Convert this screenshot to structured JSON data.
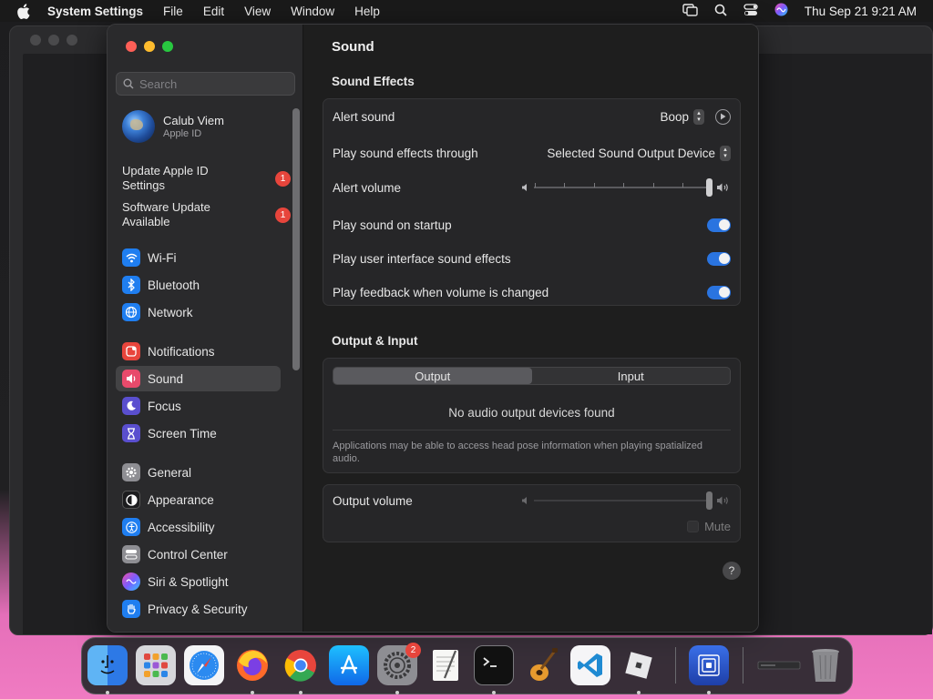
{
  "menubar": {
    "app_name": "System Settings",
    "items": [
      "File",
      "Edit",
      "View",
      "Window",
      "Help"
    ],
    "clock": "Thu Sep 21  9:21 AM"
  },
  "sidebar": {
    "search_placeholder": "Search",
    "account": {
      "name": "Calub Viem",
      "subtitle": "Apple ID"
    },
    "notices": [
      {
        "label": "Update Apple ID Settings",
        "badge": "1"
      },
      {
        "label": "Software Update Available",
        "badge": "1"
      }
    ],
    "items": [
      {
        "label": "Wi-Fi",
        "icon": "wifi-icon",
        "color": "#1f7ef0"
      },
      {
        "label": "Bluetooth",
        "icon": "bluetooth-icon",
        "color": "#1f7ef0"
      },
      {
        "label": "Network",
        "icon": "network-globe-icon",
        "color": "#1f7ef0"
      },
      {
        "label": "Notifications",
        "icon": "notifications-icon",
        "color": "#e8453c"
      },
      {
        "label": "Sound",
        "icon": "sound-icon",
        "color": "#e84a6b"
      },
      {
        "label": "Focus",
        "icon": "focus-moon-icon",
        "color": "#5a4fcf"
      },
      {
        "label": "Screen Time",
        "icon": "screen-time-hourglass-icon",
        "color": "#5a4fcf"
      },
      {
        "label": "General",
        "icon": "general-gear-icon",
        "color": "#8e8e93"
      },
      {
        "label": "Appearance",
        "icon": "appearance-icon",
        "color": "#1c1c1e"
      },
      {
        "label": "Accessibility",
        "icon": "accessibility-icon",
        "color": "#1f7ef0"
      },
      {
        "label": "Control Center",
        "icon": "control-center-icon",
        "color": "#8e8e93"
      },
      {
        "label": "Siri & Spotlight",
        "icon": "siri-icon",
        "color": "#b23bd4"
      },
      {
        "label": "Privacy & Security",
        "icon": "privacy-hand-icon",
        "color": "#1f7ef0"
      }
    ],
    "selected": "Sound"
  },
  "content": {
    "title": "Sound",
    "sound_effects": {
      "heading": "Sound Effects",
      "alert_sound": {
        "label": "Alert sound",
        "value": "Boop"
      },
      "play_through": {
        "label": "Play sound effects through",
        "value": "Selected Sound Output Device"
      },
      "alert_volume": {
        "label": "Alert volume",
        "level": 1.0
      },
      "startup": {
        "label": "Play sound on startup",
        "on": true
      },
      "ui_effects": {
        "label": "Play user interface sound effects",
        "on": true
      },
      "feedback": {
        "label": "Play feedback when volume is changed",
        "on": true
      }
    },
    "output_input": {
      "heading": "Output & Input",
      "tabs": [
        "Output",
        "Input"
      ],
      "selected_tab": "Output",
      "empty_message": "No audio output devices found",
      "note": "Applications may be able to access head pose information when playing spatialized audio."
    },
    "output_volume": {
      "label": "Output volume",
      "level": 1.0,
      "mute_label": "Mute",
      "muted": false
    },
    "help": "?"
  },
  "dock": {
    "apps": [
      {
        "name": "Finder",
        "icon": "finder-icon"
      },
      {
        "name": "Launchpad",
        "icon": "launchpad-icon"
      },
      {
        "name": "Safari",
        "icon": "safari-icon"
      },
      {
        "name": "Firefox",
        "icon": "firefox-icon"
      },
      {
        "name": "Chrome",
        "icon": "chrome-icon"
      },
      {
        "name": "App Store",
        "icon": "app-store-icon"
      },
      {
        "name": "System Settings",
        "icon": "system-settings-icon",
        "badge": "2"
      },
      {
        "name": "TextEdit",
        "icon": "textedit-icon"
      },
      {
        "name": "Terminal",
        "icon": "terminal-icon"
      },
      {
        "name": "GarageBand",
        "icon": "garageband-icon"
      },
      {
        "name": "VS Code",
        "icon": "vscode-icon"
      },
      {
        "name": "Roblox",
        "icon": "roblox-icon"
      },
      {
        "name": "Screen Sharing",
        "icon": "screen-sharing-icon"
      },
      {
        "name": "Minimized Window",
        "icon": "minimized-window-icon"
      },
      {
        "name": "Trash",
        "icon": "trash-icon"
      }
    ]
  }
}
